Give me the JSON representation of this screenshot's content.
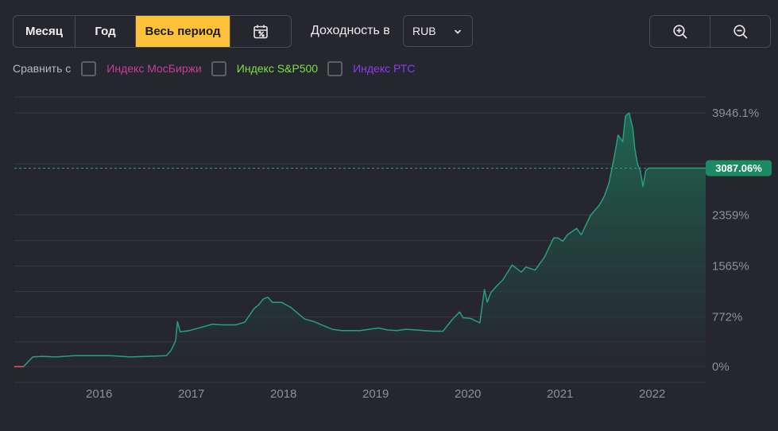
{
  "toolbar": {
    "periods": [
      {
        "label": "Месяц",
        "active": false
      },
      {
        "label": "Год",
        "active": false
      },
      {
        "label": "Весь период",
        "active": true
      }
    ],
    "calendar_icon": "calendar-percent-icon",
    "yield_label": "Доходность в",
    "currency": "RUB",
    "zoom_in_icon": "zoom-in-icon",
    "zoom_out_icon": "zoom-out-icon"
  },
  "compare": {
    "label": "Сравнить с",
    "items": [
      {
        "label": "Индекс МосБиржи",
        "color": "#c3409a",
        "checked": false
      },
      {
        "label": "Индекс S&P500",
        "color": "#7ee04a",
        "checked": false
      },
      {
        "label": "Индекс РТС",
        "color": "#8a3cf0",
        "checked": false
      }
    ]
  },
  "colors": {
    "background": "#26262e",
    "line": "#27a17c",
    "area_top": "#1f6b55",
    "area_bottom": "#262a2d",
    "current_badge": "#1d8a66",
    "start_segment": "#e2455c",
    "grid": "#383842",
    "axis_text": "#8f8f99"
  },
  "chart_data": {
    "type": "area",
    "x_ticks": [
      "2016",
      "2017",
      "2018",
      "2019",
      "2020",
      "2021",
      "2022"
    ],
    "y_ticks": [
      "0%",
      "772%",
      "1565%",
      "2359%",
      "3946.1%"
    ],
    "y_unit": "%",
    "ylim": [
      0,
      3946.1
    ],
    "xlim": [
      2015.05,
      2022.55
    ],
    "current_value_label": "3087.06%",
    "current_value": 3087.06,
    "max_value": 3946.1,
    "series": [
      {
        "x": [
          2015.05,
          2015.15,
          2015.25,
          2015.35,
          2015.5,
          2015.7,
          2015.9,
          2016.1,
          2016.3,
          2016.5,
          2016.7,
          2016.75,
          2016.8,
          2016.82,
          2016.85,
          2016.95,
          2017.1,
          2017.2,
          2017.3,
          2017.45,
          2017.55,
          2017.65,
          2017.7,
          2017.75,
          2017.8,
          2017.85,
          2017.95,
          2018.05,
          2018.15,
          2018.2,
          2018.25,
          2018.3,
          2018.4,
          2018.5,
          2018.6,
          2018.7,
          2018.8,
          2018.9,
          2019.0,
          2019.1,
          2019.2,
          2019.3,
          2019.4,
          2019.5,
          2019.6,
          2019.7,
          2019.8,
          2019.88,
          2019.92,
          2020.0,
          2020.1,
          2020.15,
          2020.18,
          2020.22,
          2020.28,
          2020.35,
          2020.45,
          2020.55,
          2020.6,
          2020.7,
          2020.8,
          2020.9,
          2020.95,
          2021.0,
          2021.05,
          2021.15,
          2021.2,
          2021.3,
          2021.4,
          2021.45,
          2021.5,
          2021.55,
          2021.6,
          2021.65,
          2021.68,
          2021.72,
          2021.76,
          2021.78,
          2021.81,
          2021.84,
          2021.87,
          2021.9,
          2021.93,
          2021.96,
          2022.0,
          2022.2,
          2022.4,
          2022.55
        ],
        "values": [
          0,
          0,
          150,
          160,
          150,
          170,
          170,
          170,
          150,
          160,
          170,
          250,
          400,
          700,
          540,
          560,
          620,
          660,
          650,
          650,
          690,
          900,
          960,
          1050,
          1080,
          1000,
          1000,
          920,
          800,
          740,
          720,
          700,
          640,
          580,
          560,
          560,
          560,
          580,
          600,
          570,
          560,
          580,
          570,
          560,
          550,
          550,
          730,
          850,
          760,
          750,
          680,
          1200,
          1000,
          1150,
          1250,
          1350,
          1580,
          1470,
          1550,
          1500,
          1700,
          2000,
          2000,
          1950,
          2050,
          2150,
          2050,
          2350,
          2520,
          2650,
          2850,
          3200,
          3600,
          3500,
          3900,
          3946.1,
          3700,
          3400,
          3150,
          3050,
          2800,
          3050,
          3087.06,
          3087.06,
          3087.06,
          3087.06,
          3087.06,
          3087.06
        ]
      }
    ],
    "grid": true,
    "current_line": "dashed"
  }
}
